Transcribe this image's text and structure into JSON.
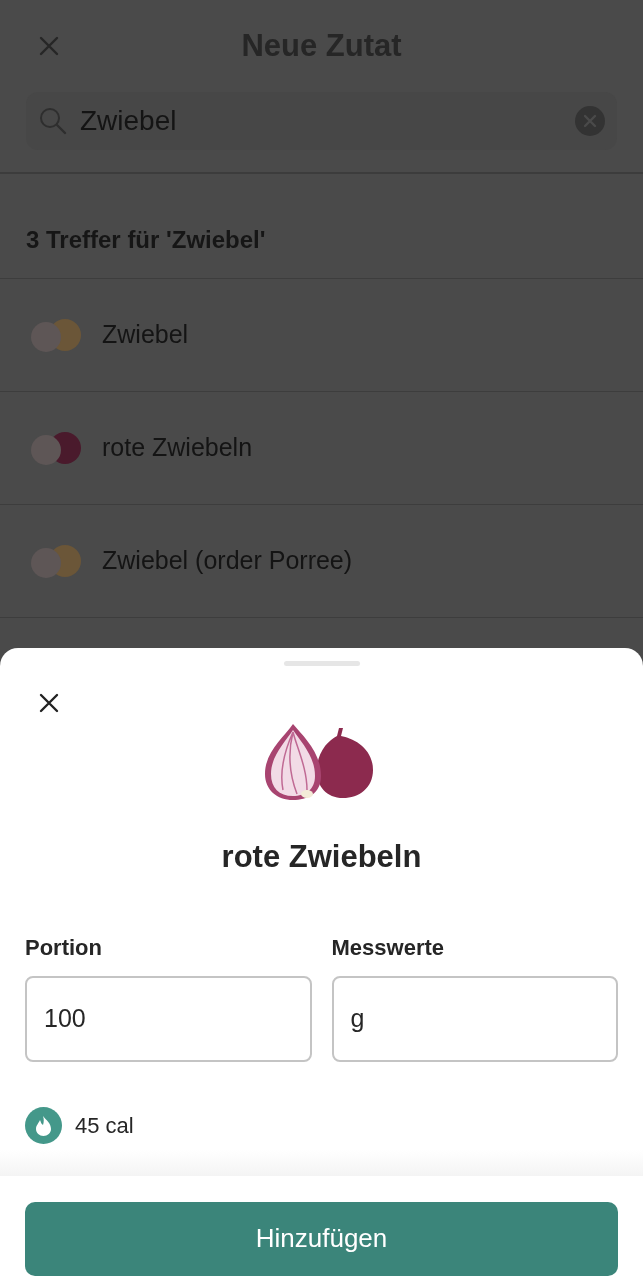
{
  "header": {
    "title": "Neue Zutat"
  },
  "search": {
    "value": "Zwiebel"
  },
  "results_heading": "3 Treffer für 'Zwiebel'",
  "results": [
    {
      "label": "Zwiebel",
      "color": "#6b5638"
    },
    {
      "label": "rote Zwiebeln",
      "color": "#4a1a2c"
    },
    {
      "label": "Zwiebel (order Porree)",
      "color": "#6b5638"
    }
  ],
  "sheet": {
    "title": "rote Zwiebeln",
    "portion": {
      "label": "Portion",
      "value": "100"
    },
    "unit": {
      "label": "Messwerte",
      "value": "g"
    },
    "calories": "45 cal",
    "button": "Hinzufügen"
  }
}
